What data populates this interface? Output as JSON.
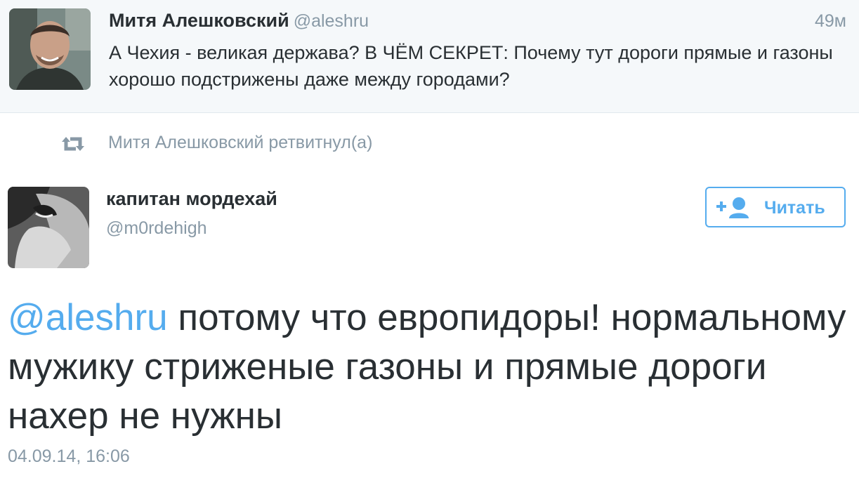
{
  "quoted_tweet": {
    "author_name": "Митя Алешковский",
    "author_handle": "@aleshru",
    "time": "49м",
    "text": "А Чехия - великая держава? В ЧЁМ СЕКРЕТ: Почему тут дороги прямые и газоны хорошо подстрижены даже между городами?"
  },
  "retweet": {
    "label": "Митя Алешковский ретвитнул(а)",
    "icon": "retweet-icon"
  },
  "main_tweet": {
    "author_name": "капитан мордехай",
    "author_handle": "@m0rdehigh",
    "follow_label": "Читать",
    "follow_icon": "add-user-icon",
    "mention": "@aleshru",
    "text_rest": " потому что европидоры! нормальному мужику стриженые газоны и  прямые дороги нахер не нужны",
    "timestamp": "04.09.14, 16:06"
  },
  "colors": {
    "accent": "#55acee",
    "text": "#292f33",
    "muted": "#8899a6",
    "quoted_bg": "#f5f8fa"
  }
}
